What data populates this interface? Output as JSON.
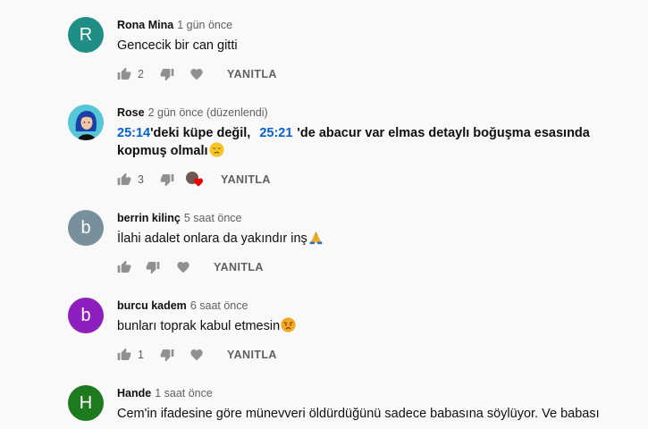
{
  "comments": [
    {
      "author": "Rona Mina",
      "time": "1 gün önce",
      "avatar_letter": "R",
      "avatar_color": "#1f8f85",
      "text": "Gencecik bir can gitti",
      "likes": "2",
      "reply": "YANITLA"
    },
    {
      "author": "Rose",
      "time": "2 gün önce (düzenlendi)",
      "avatar_color": "#56c6d8",
      "text_ts1": "25:14",
      "text_part1": "'deki küpe değil,",
      "text_ts2": "25:21",
      "text_part2": "'de abacur var elmas detaylı boğuşma esasında",
      "text_line2": "kopmuş olmalı",
      "emoji": "disappointed-face-emoji",
      "likes": "3",
      "reply": "YANITLA"
    },
    {
      "author": "berrin kilinç",
      "time": "5 saat önce",
      "avatar_letter": "b",
      "avatar_color": "#78909c",
      "text": "İlahi adalet onlara da yakındır inş",
      "emoji": "folded-hands-emoji",
      "reply": "YANITLA"
    },
    {
      "author": "burcu kadem",
      "time": "6 saat önce",
      "avatar_letter": "b",
      "avatar_color": "#8e1fbf",
      "text": "bunları toprak kabul etmesin",
      "emoji": "angry-face-emoji",
      "likes": "1",
      "reply": "YANITLA"
    },
    {
      "author": "Hande",
      "time": "1 saat önce",
      "avatar_letter": "H",
      "avatar_color": "#1e7a1e",
      "text": "Cem'in ifadesine göre münevveri öldürdüğünü sadece babasına söylüyor. Ve babası"
    }
  ]
}
